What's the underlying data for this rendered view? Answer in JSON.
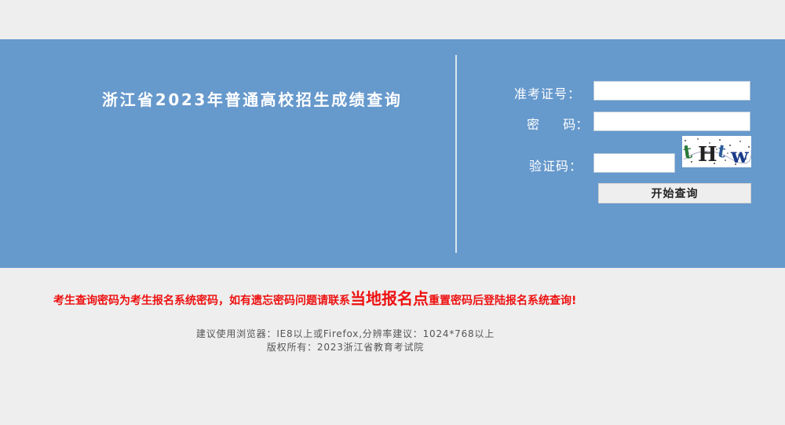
{
  "header": {
    "title": "浙江省2023年普通高校招生成绩查询"
  },
  "form": {
    "exam_id_label": "准考证号：",
    "password_label_a": "密",
    "password_label_b": "码：",
    "captcha_label": "验证码：",
    "captcha_text": "tHtw",
    "submit_label": "开始查询",
    "exam_id_value": "",
    "password_value": "",
    "captcha_value": ""
  },
  "notice": {
    "part1": "考生查询密码为考生报名系统密码，如有遗忘密码问题请联系",
    "highlight": "当地报名点",
    "part2": "重置密码后登陆报名系统查询!"
  },
  "footer": {
    "browser": "建议使用浏览器：IE8以上或Firefox,分辨率建议：1024*768以上",
    "copyright": "版权所有：2023浙江省教育考试院"
  },
  "colors": {
    "banner": "#6699cc",
    "notice": "#ee1111",
    "background": "#eeeeee"
  }
}
